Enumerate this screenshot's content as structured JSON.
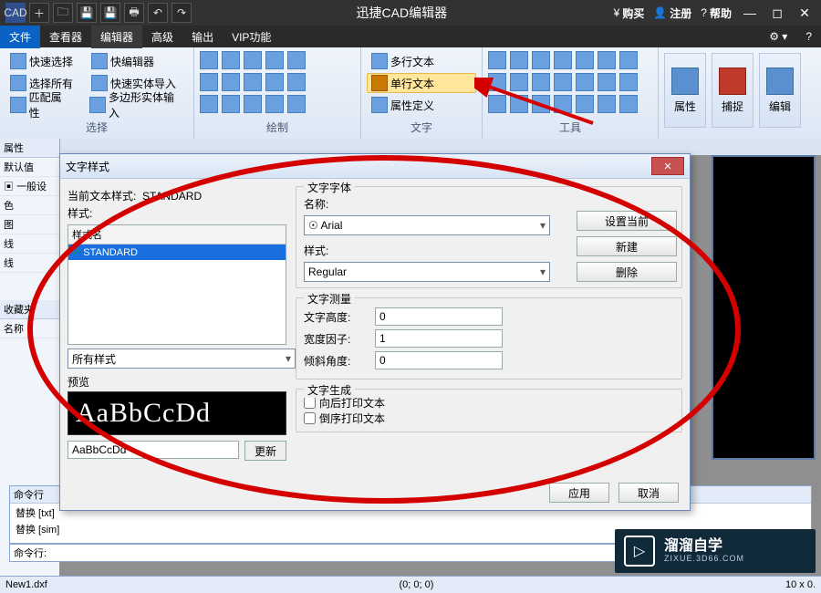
{
  "title": "迅捷CAD编辑器",
  "titlebar": {
    "buy": "购买",
    "register": "注册",
    "help": "帮助"
  },
  "menu": {
    "file": "文件",
    "viewer": "查看器",
    "editor": "编辑器",
    "advanced": "高级",
    "output": "输出",
    "vip": "VIP功能"
  },
  "ribbon": {
    "sel": {
      "quick": "快速选择",
      "editor": "快编辑器",
      "all": "选择所有",
      "import": "快速实体导入",
      "match": "匹配属性",
      "poly": "多边形实体输入",
      "label": "选择"
    },
    "draw": {
      "label": "绘制"
    },
    "text": {
      "mtext": "多行文本",
      "stext": "单行文本",
      "attdef": "属性定义",
      "label": "文字"
    },
    "tools": {
      "label": "工具"
    },
    "big": {
      "props": "属性",
      "snap": "捕捉",
      "edit": "编辑"
    }
  },
  "doc_tab": "New1.dxf",
  "side": {
    "props": "属性",
    "defaults": "默认值",
    "general": "一般设",
    "color": "色",
    "layer": "图",
    "ltype": "线",
    "lweight": "线",
    "fav": "收藏夹",
    "name": "名称"
  },
  "cmd": {
    "header": "命令行",
    "l1": "替换 [txt]",
    "l2": "替换 [sim]",
    "prompt": "命令行:"
  },
  "status": {
    "file": "New1.dxf",
    "coord": "(0; 0; 0)",
    "zoom": "10 x 0."
  },
  "dialog": {
    "title": "文字样式",
    "current_label": "当前文本样式:",
    "current": "STANDARD",
    "styles_label": "样式:",
    "col": "样式名",
    "item": "STANDARD",
    "filter": "所有样式",
    "preview_label": "预览",
    "sample_big": "AaBbCcDd",
    "sample_small": "AaBbCcDd",
    "update": "更新",
    "font_group": "文字字体",
    "name_label": "名称:",
    "font": "Arial",
    "style_label": "样式:",
    "style": "Regular",
    "measure_group": "文字测量",
    "height_label": "文字高度:",
    "height": "0",
    "width_label": "宽度因子:",
    "width": "1",
    "oblique_label": "倾斜角度:",
    "oblique": "0",
    "gen_group": "文字生成",
    "backwards": "向后打印文本",
    "upside": "倒序打印文本",
    "set_current": "设置当前",
    "new": "新建",
    "delete": "删除",
    "apply": "应用",
    "cancel": "取消"
  },
  "watermark": {
    "t1": "溜溜自学",
    "t2": "ZIXUE.3D66.COM"
  }
}
